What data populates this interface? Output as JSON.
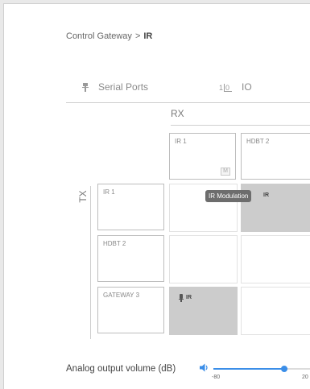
{
  "breadcrumb": {
    "parent": "Control Gateway",
    "separator": ">",
    "current": "IR"
  },
  "tabs": [
    {
      "label": "Serial Ports",
      "icon": "serial-port-icon"
    },
    {
      "label": "IO",
      "icon": "io-icon"
    }
  ],
  "matrix": {
    "rx_label": "RX",
    "tx_label": "TX",
    "rx_ports": [
      {
        "label": "IR 1",
        "badge": "M"
      },
      {
        "label": "HDBT 2"
      }
    ],
    "tx_ports": [
      {
        "label": "IR 1"
      },
      {
        "label": "HDBT 2"
      },
      {
        "label": "GATEWAY 3"
      }
    ],
    "routes": [
      {
        "tx": "IR 1",
        "rx": "HDBT 2",
        "text": "IR"
      },
      {
        "tx": "GATEWAY 3",
        "rx": "IR 1",
        "text": "IR",
        "icon": "ir-transmitter-icon"
      }
    ],
    "tooltip": "IR Modulation"
  },
  "volume": {
    "label": "Analog output volume (dB)",
    "min": "-80",
    "max": "20",
    "value_fraction": 0.85,
    "icon": "speaker-icon"
  },
  "colors": {
    "accent": "#3b8ee8",
    "active_cell": "#cccccc"
  }
}
